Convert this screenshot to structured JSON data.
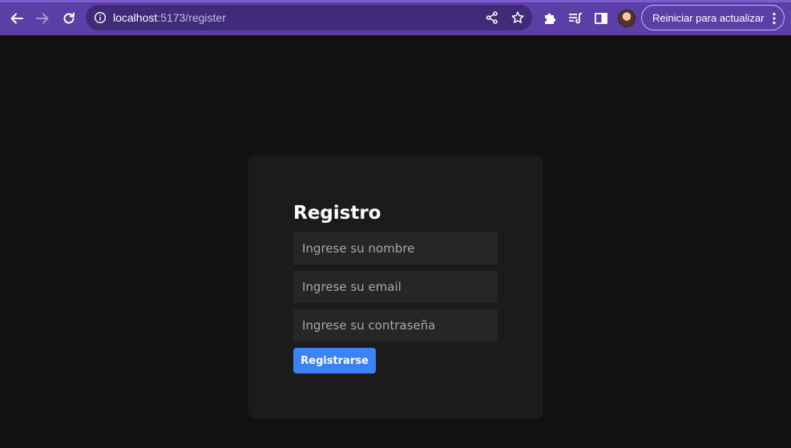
{
  "browser": {
    "url_host": "localhost",
    "url_rest": ":5173/register",
    "update_button_label": "Reiniciar para actualizar",
    "icons": [
      "back-icon",
      "forward-icon",
      "reload-icon",
      "info-icon",
      "share-icon",
      "star-icon",
      "extensions-icon",
      "reading-list-icon",
      "side-panel-icon",
      "more-icon"
    ],
    "accent_color": "#5b3fa6"
  },
  "register": {
    "title": "Registro",
    "name_placeholder": "Ingrese su nombre",
    "email_placeholder": "Ingrese su email",
    "password_placeholder": "Ingrese su contraseña",
    "submit_label": "Registrarse",
    "button_color": "#3b82f6"
  }
}
